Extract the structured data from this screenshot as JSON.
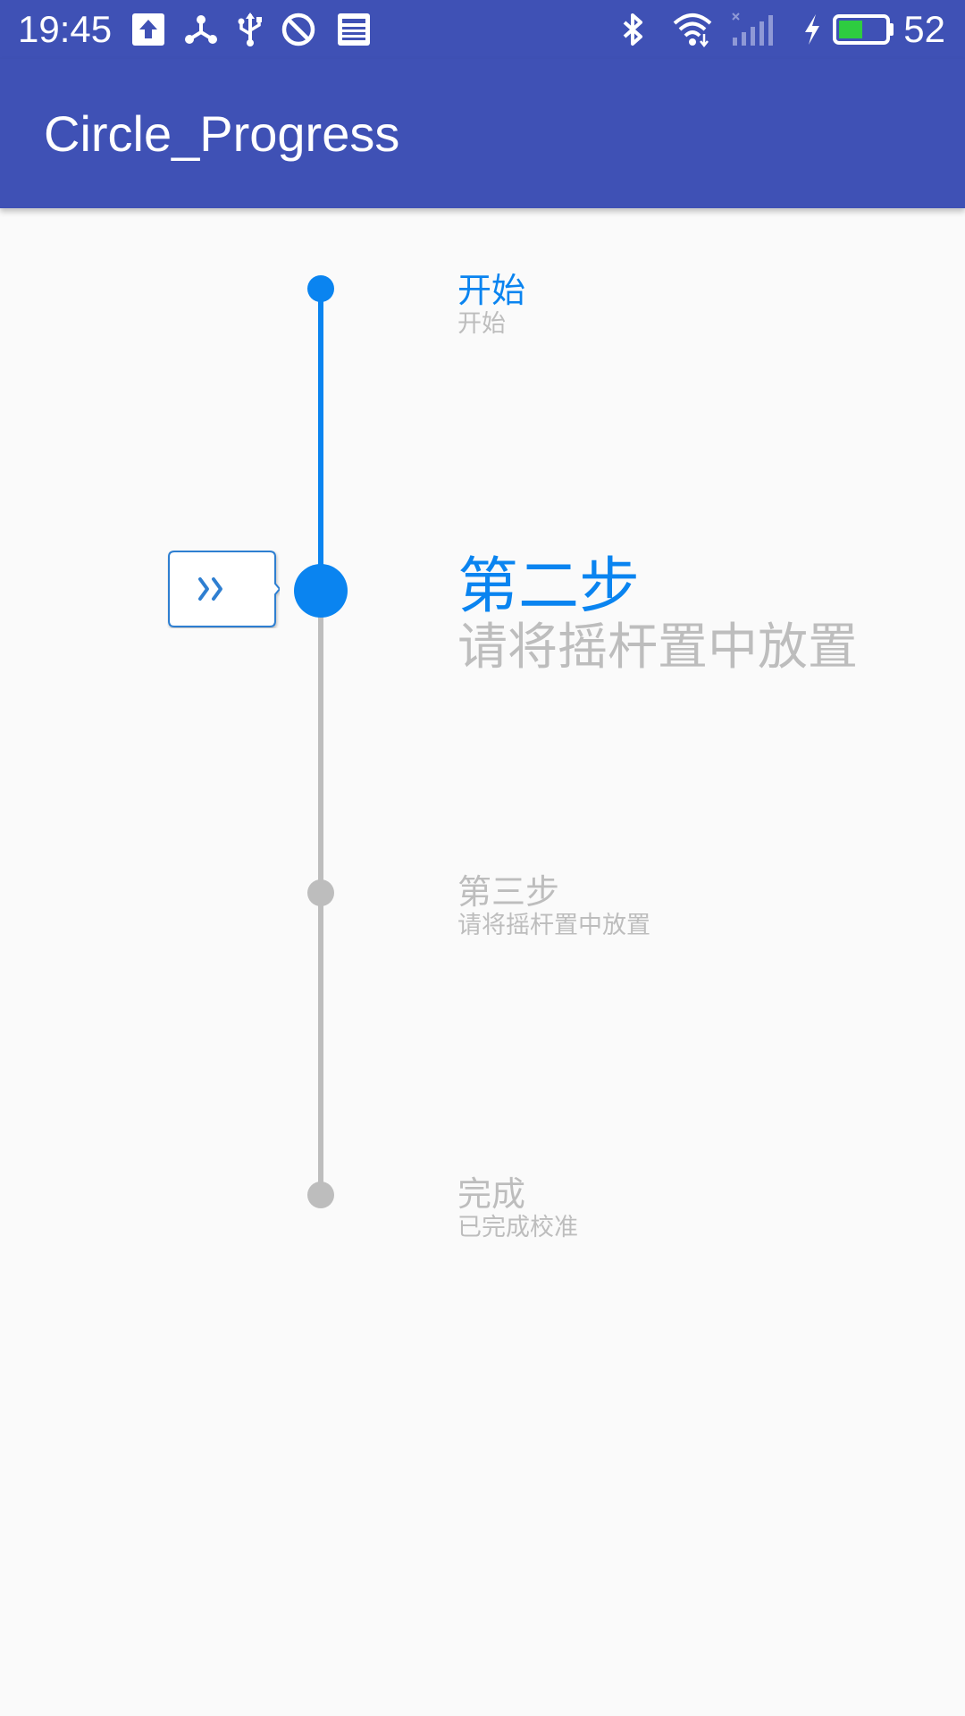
{
  "status_bar": {
    "time": "19:45",
    "left_icons": [
      "upload-icon",
      "share-hub-icon",
      "usb-icon",
      "do-not-disturb-icon",
      "news-icon"
    ],
    "right_icons": [
      "bluetooth-icon",
      "wifi-icon",
      "signal-icon",
      "charging-icon",
      "battery-icon"
    ],
    "battery_level": 52,
    "battery_text": "52"
  },
  "app_bar": {
    "title": "Circle_Progress"
  },
  "stepper": {
    "current_step": 2,
    "bubble_icon": "double-chevron-right-icon",
    "steps": [
      {
        "title": "开始",
        "subtitle": "开始",
        "state": "done"
      },
      {
        "title": "第二步",
        "subtitle": "请将摇杆置中放置",
        "state": "current"
      },
      {
        "title": "第三步",
        "subtitle": "请将摇杆置中放置",
        "state": "pending"
      },
      {
        "title": "完成",
        "subtitle": "已完成校准",
        "state": "pending"
      }
    ]
  },
  "colors": {
    "primary": "#3f51b5",
    "accent_blue": "#0a84f0",
    "inactive_gray": "#bdbdbd",
    "background": "#fafafa",
    "battery_fill": "#2ecc40"
  }
}
